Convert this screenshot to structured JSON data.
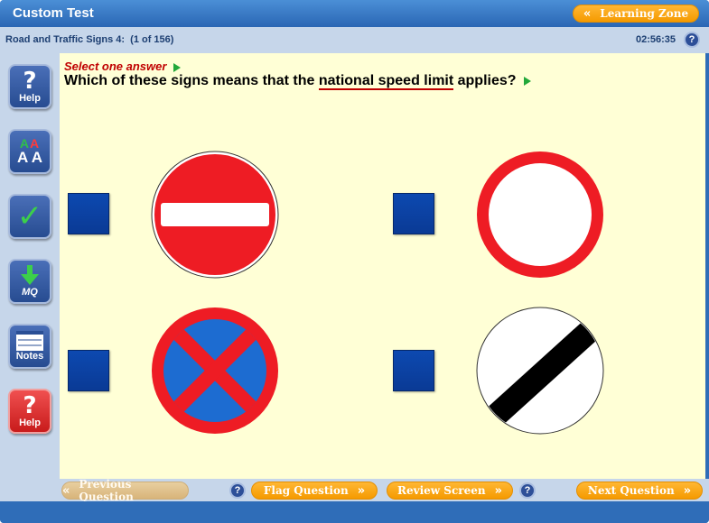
{
  "window": {
    "title": "Custom Test",
    "learning_zone_label": "Learning Zone"
  },
  "infobar": {
    "section": "Road and Traffic Signs 4:",
    "progress": "(1 of 156)",
    "timer": "02:56:35",
    "help_glyph": "?"
  },
  "sidebar": {
    "items": [
      {
        "icon": "question-mark-icon",
        "glyph": "?",
        "label": "Help"
      },
      {
        "icon": "text-size-icon",
        "glyph_top": "A A",
        "glyph": "A A",
        "label": ""
      },
      {
        "icon": "checkmark-icon",
        "glyph": "✓",
        "label": ""
      },
      {
        "icon": "down-arrow-icon",
        "glyph": "",
        "label": "MQ"
      },
      {
        "icon": "notes-icon",
        "glyph": "",
        "label": "Notes"
      },
      {
        "icon": "question-mark-icon",
        "glyph": "?",
        "label": "Help"
      }
    ]
  },
  "question": {
    "instruction": "Select one answer",
    "text_before": "Which of these signs means that the ",
    "highlight": "national speed limit",
    "text_after": " applies?"
  },
  "answers": [
    {
      "sign": "no-entry-sign",
      "colors": {
        "fill": "#ee1c24",
        "bar": "#ffffff"
      }
    },
    {
      "sign": "no-vehicles-sign",
      "colors": {
        "ring": "#ee1c24",
        "fill": "#ffffff"
      }
    },
    {
      "sign": "clearway-sign",
      "colors": {
        "ring": "#ee1c24",
        "fill": "#1d6cd1"
      }
    },
    {
      "sign": "national-speed-limit-sign",
      "colors": {
        "fill": "#ffffff",
        "stripe": "#000000"
      }
    }
  ],
  "nav": {
    "previous_label": "Previous Question",
    "flag_label": "Flag Question",
    "review_label": "Review Screen",
    "next_label": "Next Question",
    "help_glyph": "?",
    "left_chevron": "«",
    "right_chevron": "»"
  },
  "colors": {
    "accent_orange": "#f59a00",
    "frame_blue": "#2f6db8",
    "answer_box_blue": "#0d49b0",
    "question_bg": "#ffffd6"
  }
}
